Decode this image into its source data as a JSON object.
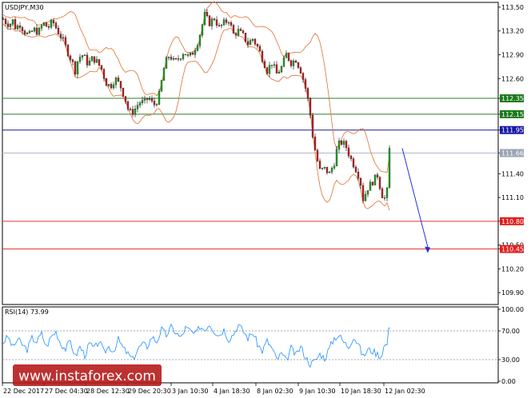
{
  "chart_data": {
    "type": "candlestick",
    "symbol_label": "USDJPY,M30",
    "ylim": [
      109.75,
      113.55
    ],
    "y_ticks": [
      "113.50",
      "113.20",
      "112.90",
      "112.60",
      "112.35",
      "112.15",
      "111.95",
      "111.66",
      "111.40",
      "111.10",
      "110.80",
      "110.50",
      "110.45",
      "110.20",
      "109.90"
    ],
    "x_ticks": [
      "22 Dec 2017",
      "27 Dec 04:30",
      "28 Dec 12:30",
      "29 Dec 20:30",
      "3 Jan 10:30",
      "4 Jan 18:30",
      "8 Jan 02:30",
      "9 Jan 10:30",
      "10 Jan 18:30",
      "12 Jan 02:30"
    ],
    "levels": [
      {
        "label": "112.35",
        "value": 112.35,
        "color": "#2e7d32",
        "tag_color": "#1b7a1b"
      },
      {
        "label": "112.15",
        "value": 112.15,
        "color": "#2e7d32",
        "tag_color": "#1b7a1b"
      },
      {
        "label": "111.95",
        "value": 111.95,
        "color": "#1a1a9e",
        "tag_color": "#1a1aa8"
      },
      {
        "label": "111.66",
        "value": 111.66,
        "color": "#b0b8c8",
        "tag_color": "#9aa4b4"
      },
      {
        "label": "110.80",
        "value": 110.8,
        "color": "#e53935",
        "tag_color": "#e02020"
      },
      {
        "label": "110.45",
        "value": 110.45,
        "color": "#e53935",
        "tag_color": "#e02020"
      }
    ],
    "forecast": {
      "from": 111.72,
      "to": 110.43,
      "color": "#2233dd"
    },
    "colors": {
      "up": "#22aa22",
      "down": "#cc2222",
      "band": "#e07030",
      "rsi": "#1e90ff"
    },
    "rsi": {
      "label": "RSI(14) 73.99",
      "ylim": [
        0,
        100
      ],
      "ticks": [
        "100.00",
        "70.00",
        "30.00",
        "0.00"
      ],
      "levels": [
        70,
        30
      ]
    },
    "path": [
      [
        0,
        113.35
      ],
      [
        4,
        113.3
      ],
      [
        8,
        113.28
      ],
      [
        12,
        113.33
      ],
      [
        16,
        113.22
      ],
      [
        20,
        113.3
      ],
      [
        26,
        113.2
      ],
      [
        32,
        113.14
      ],
      [
        38,
        113.22
      ],
      [
        44,
        113.18
      ],
      [
        50,
        113.3
      ],
      [
        56,
        113.24
      ],
      [
        62,
        113.32
      ],
      [
        68,
        113.2
      ],
      [
        74,
        113.1
      ],
      [
        80,
        112.95
      ],
      [
        86,
        112.82
      ],
      [
        90,
        112.7
      ],
      [
        94,
        112.86
      ],
      [
        100,
        112.9
      ],
      [
        106,
        112.78
      ],
      [
        112,
        112.86
      ],
      [
        118,
        112.8
      ],
      [
        124,
        112.7
      ],
      [
        128,
        112.55
      ],
      [
        134,
        112.5
      ],
      [
        140,
        112.6
      ],
      [
        146,
        112.52
      ],
      [
        152,
        112.36
      ],
      [
        156,
        112.22
      ],
      [
        160,
        112.16
      ],
      [
        164,
        112.2
      ],
      [
        170,
        112.3
      ],
      [
        176,
        112.3
      ],
      [
        182,
        112.36
      ],
      [
        188,
        112.26
      ],
      [
        194,
        112.34
      ],
      [
        198,
        112.56
      ],
      [
        202,
        112.78
      ],
      [
        208,
        112.9
      ],
      [
        214,
        112.8
      ],
      [
        220,
        112.86
      ],
      [
        226,
        112.94
      ],
      [
        232,
        112.86
      ],
      [
        238,
        112.94
      ],
      [
        244,
        113.08
      ],
      [
        248,
        113.24
      ],
      [
        252,
        113.4
      ],
      [
        258,
        113.3
      ],
      [
        264,
        113.36
      ],
      [
        270,
        113.24
      ],
      [
        276,
        113.3
      ],
      [
        282,
        113.34
      ],
      [
        288,
        113.16
      ],
      [
        294,
        113.2
      ],
      [
        300,
        113.14
      ],
      [
        306,
        113.04
      ],
      [
        312,
        113.1
      ],
      [
        318,
        113.0
      ],
      [
        324,
        112.86
      ],
      [
        330,
        112.7
      ],
      [
        336,
        112.8
      ],
      [
        342,
        112.66
      ],
      [
        348,
        112.74
      ],
      [
        354,
        112.9
      ],
      [
        360,
        112.8
      ],
      [
        366,
        112.84
      ],
      [
        372,
        112.7
      ],
      [
        376,
        112.56
      ],
      [
        380,
        112.4
      ],
      [
        384,
        112.14
      ],
      [
        388,
        111.8
      ],
      [
        392,
        111.6
      ],
      [
        396,
        111.44
      ],
      [
        402,
        111.46
      ],
      [
        408,
        111.4
      ],
      [
        414,
        111.54
      ],
      [
        418,
        111.74
      ],
      [
        422,
        111.8
      ],
      [
        428,
        111.76
      ],
      [
        434,
        111.6
      ],
      [
        440,
        111.48
      ],
      [
        446,
        111.34
      ],
      [
        450,
        111.08
      ],
      [
        456,
        111.22
      ],
      [
        462,
        111.3
      ],
      [
        468,
        111.38
      ],
      [
        472,
        111.2
      ],
      [
        476,
        111.06
      ],
      [
        480,
        111.18
      ],
      [
        484,
        111.72
      ]
    ],
    "rsi_path": [
      [
        0,
        54
      ],
      [
        6,
        62
      ],
      [
        12,
        47
      ],
      [
        18,
        58
      ],
      [
        24,
        51
      ],
      [
        30,
        44
      ],
      [
        36,
        60
      ],
      [
        42,
        55
      ],
      [
        48,
        66
      ],
      [
        54,
        48
      ],
      [
        60,
        62
      ],
      [
        66,
        69
      ],
      [
        72,
        52
      ],
      [
        78,
        45
      ],
      [
        84,
        56
      ],
      [
        90,
        34
      ],
      [
        96,
        48
      ],
      [
        102,
        36
      ],
      [
        108,
        52
      ],
      [
        114,
        45
      ],
      [
        120,
        56
      ],
      [
        126,
        40
      ],
      [
        132,
        48
      ],
      [
        138,
        42
      ],
      [
        144,
        58
      ],
      [
        150,
        46
      ],
      [
        156,
        38
      ],
      [
        162,
        30
      ],
      [
        168,
        44
      ],
      [
        174,
        52
      ],
      [
        180,
        48
      ],
      [
        186,
        62
      ],
      [
        192,
        55
      ],
      [
        198,
        72
      ],
      [
        204,
        64
      ],
      [
        210,
        75
      ],
      [
        216,
        68
      ],
      [
        222,
        60
      ],
      [
        228,
        74
      ],
      [
        234,
        70
      ],
      [
        240,
        64
      ],
      [
        246,
        76
      ],
      [
        252,
        72
      ],
      [
        258,
        80
      ],
      [
        264,
        70
      ],
      [
        270,
        64
      ],
      [
        276,
        72
      ],
      [
        282,
        58
      ],
      [
        288,
        66
      ],
      [
        294,
        78
      ],
      [
        300,
        70
      ],
      [
        306,
        60
      ],
      [
        312,
        68
      ],
      [
        318,
        52
      ],
      [
        324,
        42
      ],
      [
        330,
        56
      ],
      [
        336,
        46
      ],
      [
        342,
        30
      ],
      [
        348,
        38
      ],
      [
        354,
        28
      ],
      [
        360,
        46
      ],
      [
        366,
        36
      ],
      [
        372,
        48
      ],
      [
        378,
        34
      ],
      [
        384,
        24
      ],
      [
        390,
        28
      ],
      [
        396,
        38
      ],
      [
        402,
        32
      ],
      [
        408,
        46
      ],
      [
        414,
        60
      ],
      [
        420,
        64
      ],
      [
        426,
        54
      ],
      [
        432,
        48
      ],
      [
        438,
        62
      ],
      [
        444,
        52
      ],
      [
        450,
        34
      ],
      [
        456,
        44
      ],
      [
        462,
        42
      ],
      [
        468,
        38
      ],
      [
        472,
        34
      ],
      [
        476,
        48
      ],
      [
        480,
        52
      ],
      [
        484,
        74
      ]
    ]
  },
  "watermark": {
    "text": "[  www.instaforex.com  ]"
  }
}
